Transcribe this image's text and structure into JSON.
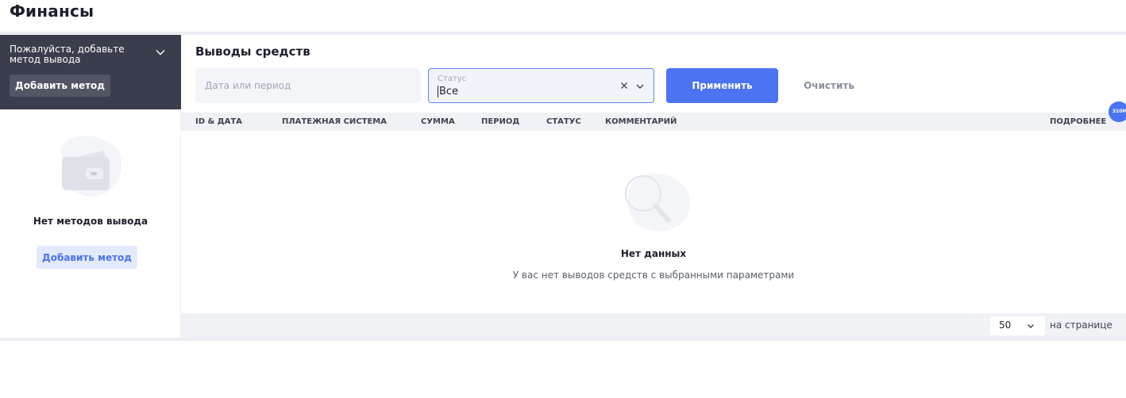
{
  "page": {
    "title": "Финансы"
  },
  "sidebar": {
    "prompt_text": "Пожалуйста, добавьте метод вывода",
    "prompt_button_label": "Добавить метод",
    "empty_text": "Нет методов вывода",
    "add_button_label": "Добавить метод"
  },
  "withdrawals": {
    "title": "Выводы средств",
    "filters": {
      "date_placeholder": "Дата или период",
      "status_label": "Статус",
      "status_value": "Все",
      "apply_label": "Применить",
      "clear_label": "Очистить"
    },
    "table": {
      "columns": [
        "ID & ДАТА",
        "ПЛАТЕЖНАЯ СИСТЕМА",
        "СУММА",
        "ПЕРИОД",
        "СТАТУС",
        "КОММЕНТАРИЙ",
        "ПОДРОБНЕЕ"
      ],
      "empty_title": "Нет данных",
      "empty_subtitle": "У вас нет выводов средств с выбранными параметрами"
    },
    "pagination": {
      "page_size": "50",
      "per_page_label": "на странице"
    }
  },
  "badge": {
    "text": "310M"
  },
  "colors": {
    "accent": "#4b73f2",
    "dark_panel": "#3a3d4c",
    "table_header_bg": "#f1f2f6"
  }
}
